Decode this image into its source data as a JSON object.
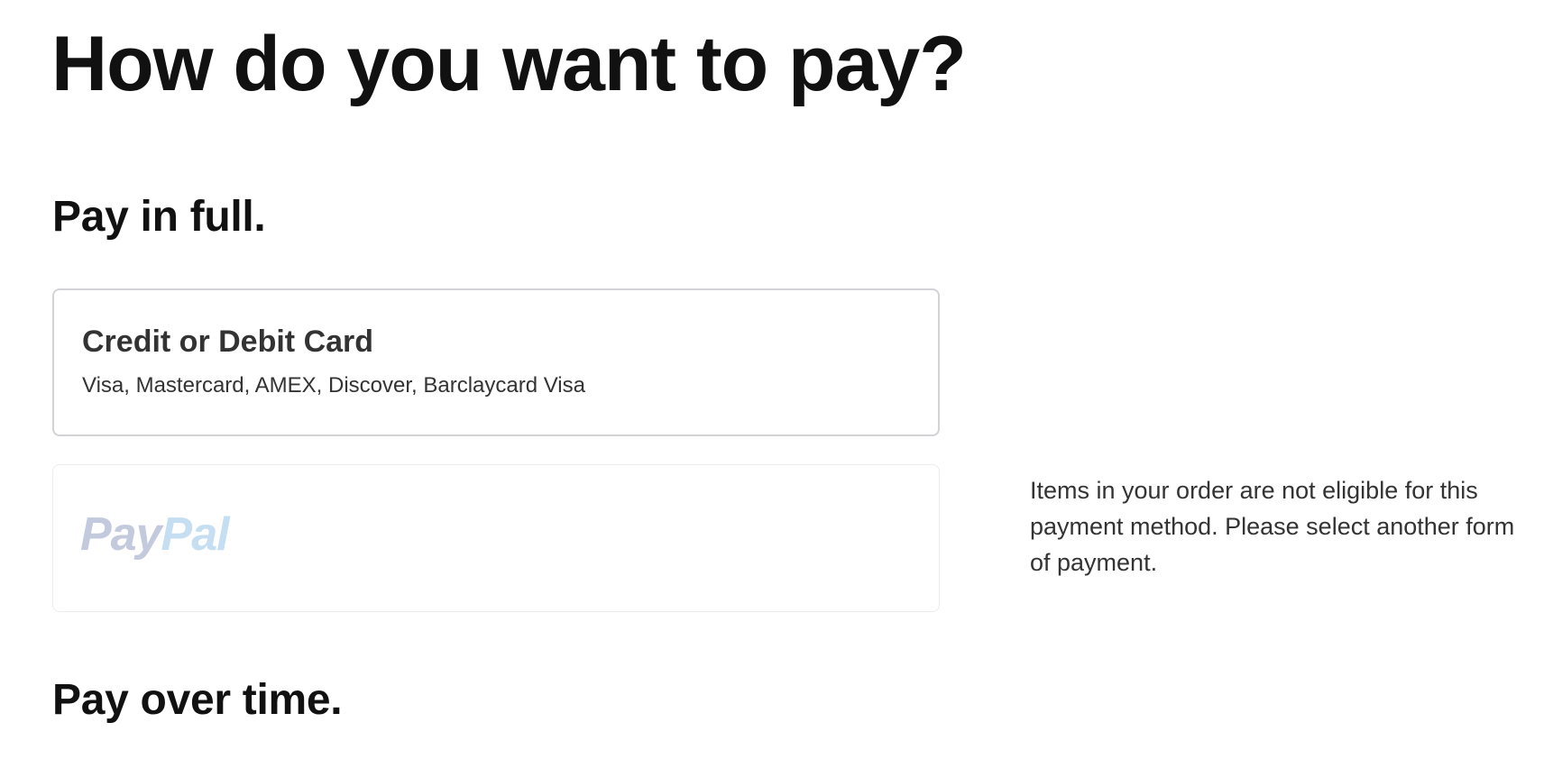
{
  "page": {
    "title": "How do you want to pay?"
  },
  "sections": {
    "pay_in_full": {
      "heading": "Pay in full."
    },
    "pay_over_time": {
      "heading": "Pay over time."
    }
  },
  "payment_options": {
    "credit_card": {
      "title": "Credit or Debit Card",
      "subtitle": "Visa, Mastercard, AMEX, Discover, Barclaycard Visa",
      "state": "available"
    },
    "paypal": {
      "logo_text_part1": "Pay",
      "logo_text_part2": "Pal",
      "state": "disabled",
      "ineligible_message": "Items in your order are not eligible for this payment method. Please select another form of payment."
    }
  },
  "colors": {
    "heading": "#111111",
    "body_text": "#333333",
    "card_border": "#d2d2d7",
    "disabled_card_border": "#ececef",
    "paypal_pay_disabled": "#c4cadd",
    "paypal_pal_disabled": "#c6def2"
  }
}
